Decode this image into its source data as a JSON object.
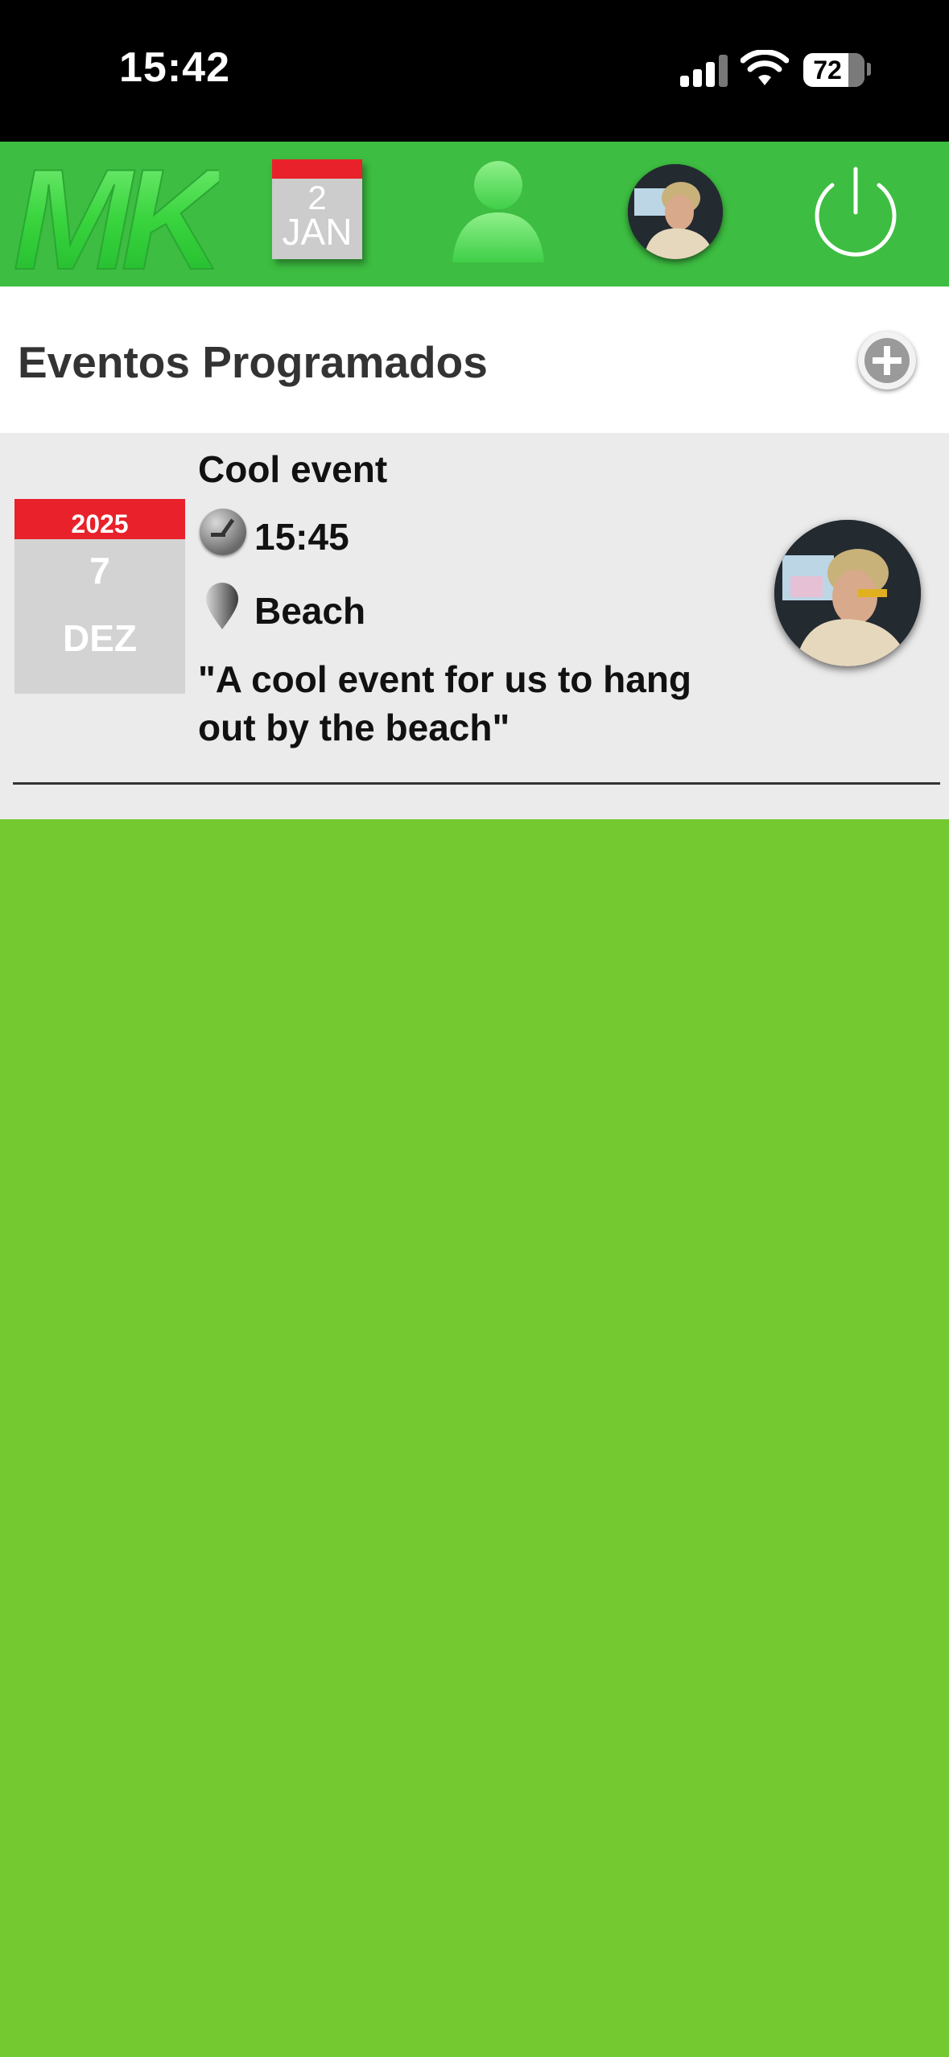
{
  "status_bar": {
    "time": "15:42",
    "battery": "72"
  },
  "nav": {
    "logo_text": "MK",
    "calendar_day": "2",
    "calendar_month": "JAN"
  },
  "header": {
    "title": "Eventos Programados"
  },
  "events": [
    {
      "title": "Cool event",
      "year": "2025",
      "day": "7",
      "month": "DEZ",
      "time": "15:45",
      "location": "Beach",
      "description": "\"A cool event for us to hang out by the beach\""
    }
  ],
  "colors": {
    "nav_green": "#3dbd41",
    "page_green": "#73c92f",
    "accent_red": "#e8212a"
  },
  "icons": [
    "clock-icon",
    "location-pin-icon",
    "add-icon",
    "power-icon",
    "person-icon",
    "calendar-icon"
  ]
}
